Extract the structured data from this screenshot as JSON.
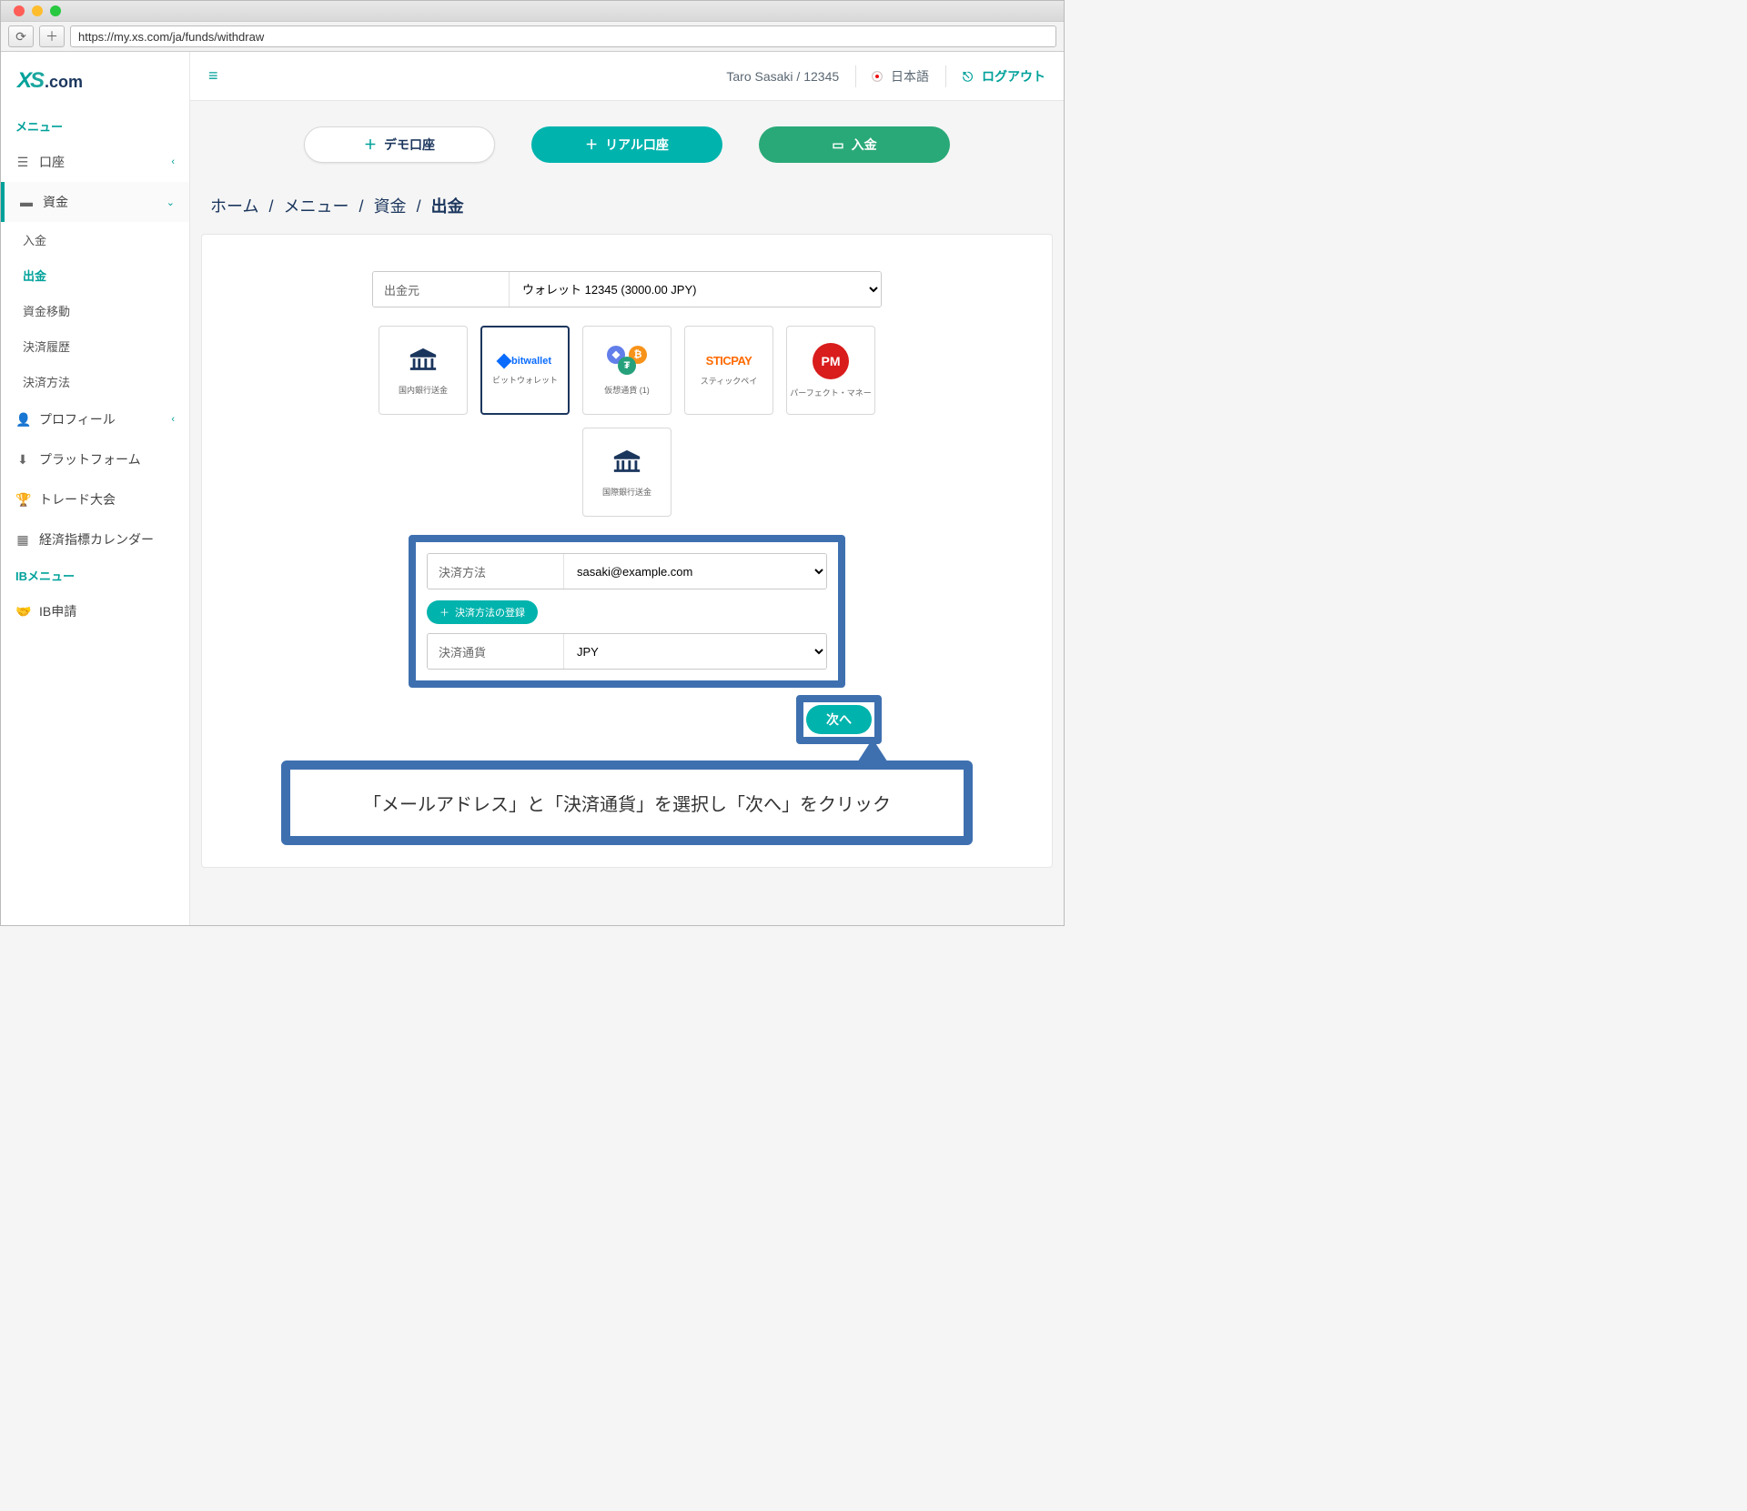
{
  "browser": {
    "url": "https://my.xs.com/ja/funds/withdraw"
  },
  "brand": {
    "x": "X",
    "s": "S",
    "com": ".com"
  },
  "sidebar": {
    "menu_header": "メニュー",
    "ib_header": "IBメニュー",
    "items": {
      "account": "口座",
      "funds": "資金",
      "profile": "プロフィール",
      "platform": "プラットフォーム",
      "contest": "トレード大会",
      "calendar": "経済指標カレンダー",
      "ib_apply": "IB申請"
    },
    "sub": {
      "deposit": "入金",
      "withdraw": "出金",
      "transfer": "資金移動",
      "history": "決済履歴",
      "methods": "決済方法"
    }
  },
  "topbar": {
    "user": "Taro Sasaki / 12345",
    "lang": "日本語",
    "logout": "ログアウト"
  },
  "actions": {
    "demo": "デモ口座",
    "live": "リアル口座",
    "deposit": "入金"
  },
  "breadcrumb": {
    "home": "ホーム",
    "menu": "メニュー",
    "funds": "資金",
    "current": "出金"
  },
  "form": {
    "source_label": "出金元",
    "source_value": "ウォレット 12345 (3000.00 JPY)",
    "methods": {
      "domestic_bank": "国内銀行送金",
      "bitwallet_logo": "bitwallet",
      "bitwallet": "ビットウォレット",
      "crypto": "仮想通貨 (1)",
      "sticpay_logo": "STICPAY",
      "sticpay": "スティックペイ",
      "perfect_money_logo": "PM",
      "perfect_money": "パーフェクト・マネー",
      "intl_bank": "国際銀行送金"
    },
    "pm_label": "決済方法",
    "pm_value": "sasaki@example.com",
    "add_pm": "決済方法の登録",
    "currency_label": "決済通貨",
    "currency_value": "JPY",
    "next": "次へ"
  },
  "callout": "「メールアドレス」と「決済通貨」を選択し「次へ」をクリック"
}
